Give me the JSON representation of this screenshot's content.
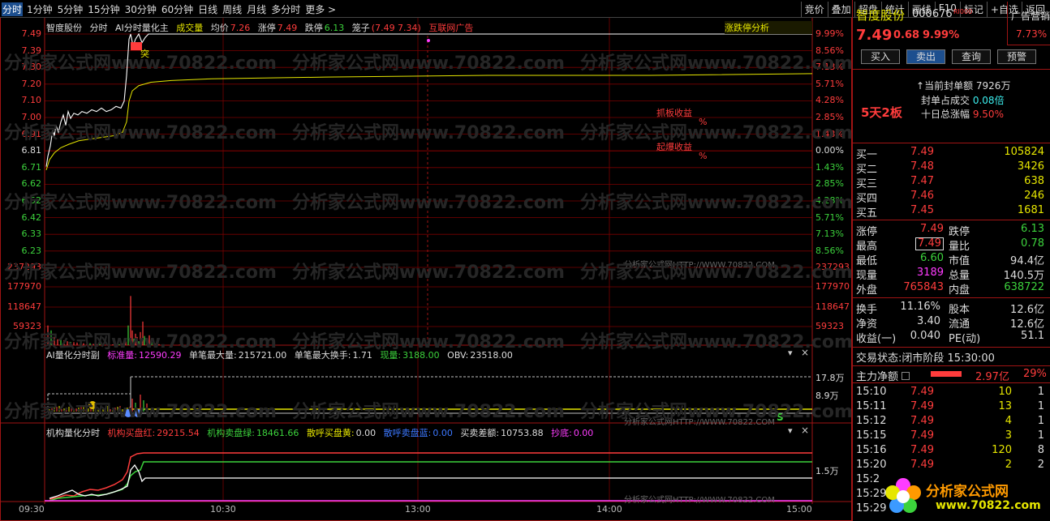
{
  "periods": [
    "分时",
    "1分钟",
    "5分钟",
    "15分钟",
    "30分钟",
    "60分钟",
    "日线",
    "周线",
    "月线",
    "多分时",
    "更多 >"
  ],
  "tools": [
    "竞价",
    "叠加",
    "超盘",
    "统计",
    "画线",
    "F10",
    "标记",
    "+自选",
    "返回"
  ],
  "chart": {
    "stock_name": "智度股份",
    "mode": "分时",
    "indicator": "AI分时量化主",
    "volume_label": "成交量",
    "avg_label": "均价",
    "avg_value": "7.26",
    "limit_up_label": "涨停",
    "limit_up_value": "7.49",
    "limit_down_label": "跌停",
    "limit_down_value": "6.13",
    "cage_label": "笼子",
    "cage_value": "(7.49 7.34)",
    "ad_text": "互联网广告",
    "limit_analysis": "涨跌停分析",
    "y_prices": [
      "7.49",
      "7.39",
      "7.30",
      "7.20",
      "7.10",
      "7.00",
      "6.91",
      "6.81",
      "6.71",
      "6.62",
      "6.52",
      "6.42",
      "6.33",
      "6.23"
    ],
    "y_pcts": [
      "9.99%",
      "8.56%",
      "7.13%",
      "5.71%",
      "4.28%",
      "2.85%",
      "1.43%",
      "0.00%",
      "1.43%",
      "2.85%",
      "4.28%",
      "5.71%",
      "7.13%",
      "8.56%"
    ],
    "vol_ticks": [
      "237293",
      "177970",
      "118647",
      "59323"
    ],
    "annotation_1": "抓板收益",
    "annotation_2": "起爆收益",
    "pct_sign": "%",
    "marker": "突",
    "watermark_line": "分析家公式网HTTP://WWW.70822.COM",
    "x_labels": [
      "09:30",
      "10:30",
      "13:00",
      "14:00",
      "15:00"
    ]
  },
  "sub1": {
    "title": "AI量化分时副",
    "std_label": "标准量:",
    "std_value": "12590.29",
    "max_vol_label": "单笔最大量:",
    "max_vol_value": "215721.00",
    "max_turn_label": "单笔最大换手:",
    "max_turn_value": "1.71",
    "cur_label": "现量:",
    "cur_value": "3188.00",
    "obv_label": "OBV:",
    "obv_value": "23518.00",
    "right_ticks": [
      "17.8万",
      "8.9万"
    ],
    "s_marker": "S"
  },
  "sub2": {
    "title": "机构量化分时",
    "buy_red_label": "机构买盘红:",
    "buy_red_value": "29215.54",
    "sell_green_label": "机构卖盘绿:",
    "sell_green_value": "18461.66",
    "retail_buy_label": "散呼买盘黄:",
    "retail_buy_value": "0.00",
    "retail_sell_label": "散呼卖盘蓝:",
    "retail_sell_value": "0.00",
    "diff_label": "买卖差额:",
    "diff_value": "10753.88",
    "bottom_label": "抄底:",
    "bottom_value": "0.00",
    "right_tick": "1.5万"
  },
  "watermark": "分析家公式网www.70822.com",
  "right": {
    "name": "智度股份",
    "code": "000676",
    "tag": "RI000",
    "ad_label": "广告营销",
    "ad_pct": "7.73%",
    "price": "7.49",
    "change": "0.68",
    "change_pct": "9.99%",
    "buttons": [
      "买入",
      "卖出",
      "查询",
      "预警"
    ],
    "seal_label": "当前封单额",
    "seal_value": "7926万",
    "seal_ratio_label": "封单占成交",
    "seal_ratio_value": "0.08倍",
    "ten_day_label": "十日总涨幅",
    "ten_day_value": "9.50%",
    "board_tag": "5天2板",
    "bids": [
      {
        "label": "买一",
        "price": "7.49",
        "vol": "105824"
      },
      {
        "label": "买二",
        "price": "7.48",
        "vol": "3426"
      },
      {
        "label": "买三",
        "price": "7.47",
        "vol": "638"
      },
      {
        "label": "买四",
        "price": "7.46",
        "vol": "246"
      },
      {
        "label": "买五",
        "price": "7.45",
        "vol": "1681"
      }
    ],
    "stats": [
      {
        "l1": "涨停",
        "v1": "7.49",
        "l2": "跌停",
        "v2": "6.13"
      },
      {
        "l1": "最高",
        "v1": "7.49",
        "l2": "量比",
        "v2": "0.78"
      },
      {
        "l1": "最低",
        "v1": "6.60",
        "l2": "市值",
        "v2": "94.4亿"
      },
      {
        "l1": "现量",
        "v1": "3189",
        "l2": "总量",
        "v2": "140.5万"
      },
      {
        "l1": "外盘",
        "v1": "765843",
        "l2": "内盘",
        "v2": "638722"
      }
    ],
    "stats2": [
      {
        "l1": "换手",
        "v1": "11.16%",
        "l2": "股本",
        "v2": "12.6亿"
      },
      {
        "l1": "净资",
        "v1": "3.40",
        "l2": "流通",
        "v2": "12.6亿"
      },
      {
        "l1": "收益(一)",
        "v1": "0.040",
        "l2": "PE(动)",
        "v2": "51.1"
      }
    ],
    "trade_status_label": "交易状态:",
    "trade_status_value": "闭市阶段 15:30:00",
    "net_label": "主力净额",
    "net_value": "2.97亿",
    "net_pct": "29%",
    "ticks": [
      {
        "t": "15:10",
        "p": "7.49",
        "v": "10",
        "n": "1"
      },
      {
        "t": "15:11",
        "p": "7.49",
        "v": "13",
        "n": "1"
      },
      {
        "t": "15:12",
        "p": "7.49",
        "v": "4",
        "n": "1"
      },
      {
        "t": "15:15",
        "p": "7.49",
        "v": "3",
        "n": "1"
      },
      {
        "t": "15:16",
        "p": "7.49",
        "v": "120",
        "n": "8"
      },
      {
        "t": "15:20",
        "p": "7.49",
        "v": "2",
        "n": "2"
      },
      {
        "t": "15:2",
        "p": "",
        "v": "",
        "n": ""
      },
      {
        "t": "15:29",
        "p": "",
        "v": "",
        "n": ""
      },
      {
        "t": "15:29",
        "p": "",
        "v": "",
        "n": ""
      }
    ],
    "logo_text": "分析家公式网",
    "logo_url": "www.70822.com"
  },
  "colors": {
    "red": "#ff3c3c",
    "green": "#3cd23c",
    "yellow": "#e6e600",
    "grid": "#8c0000",
    "white": "#ffffff",
    "magenta": "#ff3cff",
    "cyan": "#3cf0f0"
  }
}
